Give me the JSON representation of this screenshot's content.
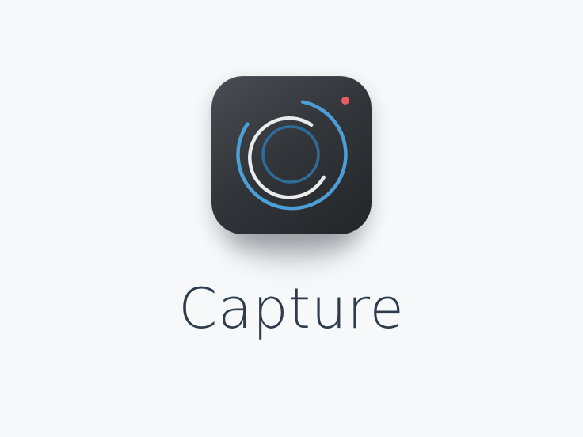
{
  "app": {
    "name": "Capture",
    "icon": "camera-lens-icon"
  },
  "colors": {
    "background": "#f6f8fa",
    "icon_dark": "#2b2d31",
    "outer_ring": "#4b9fd6",
    "middle_ring": "#e9ebed",
    "inner_ring": "#2e6d98",
    "record_dot": "#e35f63",
    "wordmark": "#2f3c4c"
  }
}
